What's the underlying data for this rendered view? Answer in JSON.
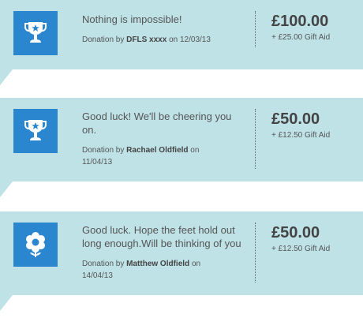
{
  "donations": [
    {
      "icon": "trophy-icon",
      "message": "Nothing is impossible!",
      "donation_by_prefix": "Donation by",
      "donor": "DFLS xxxx",
      "on_prefix": "on",
      "date": "12/03/13",
      "amount": "£100.00",
      "gift_aid": "+ £25.00 Gift Aid"
    },
    {
      "icon": "trophy-icon",
      "message": "Good luck! We'll be cheering you on.",
      "donation_by_prefix": "Donation by",
      "donor": "Rachael Oldfield",
      "on_prefix": "on",
      "date": "11/04/13",
      "amount": "£50.00",
      "gift_aid": "+ £12.50 Gift Aid"
    },
    {
      "icon": "flower-icon",
      "message": "Good luck. Hope the feet hold out long enough.Will be thinking of you",
      "donation_by_prefix": "Donation by",
      "donor": "Matthew Oldfield",
      "on_prefix": "on",
      "date": "14/04/13",
      "amount": "£50.00",
      "gift_aid": "+ £12.50 Gift Aid"
    }
  ],
  "colors": {
    "card_background": "#bfe2e7",
    "icon_background": "#2a87cf",
    "amount_text": "#444444"
  }
}
